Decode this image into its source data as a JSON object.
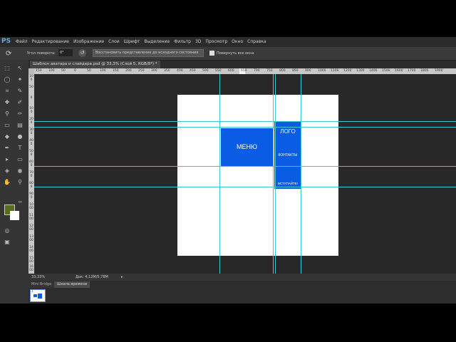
{
  "app": {
    "logo": "PS"
  },
  "menu": [
    "Файл",
    "Редактирование",
    "Изображение",
    "Слои",
    "Шрифт",
    "Выделение",
    "Фильтр",
    "3D",
    "Просмотр",
    "Окно",
    "Справка"
  ],
  "options": {
    "angle_label": "Угол поворота:",
    "angle_value": "0°",
    "reset_button": "Восстановить представление до исходного состояния",
    "rotate_all_label": "Повернуть все окна"
  },
  "document_tab": {
    "title": "Шаблон аватара и слайдера.psd @ 33,3% (Слой 5, RGB/8*) *"
  },
  "ruler": {
    "top": [
      "150",
      "100",
      "50",
      "0",
      "50",
      "100",
      "150",
      "200",
      "250",
      "300",
      "350",
      "400",
      "450",
      "500",
      "550",
      "600",
      "650",
      "700",
      "750",
      "800",
      "850",
      "900",
      "1000",
      "1100",
      "1200",
      "1300",
      "1400",
      "1500",
      "1600",
      "1700",
      "1800",
      "1900"
    ],
    "left": [
      "100",
      "50",
      "0",
      "100",
      "200",
      "300",
      "400",
      "500",
      "600",
      "700",
      "800",
      "900",
      "1000",
      "1100",
      "1200",
      "1300",
      "1400",
      "1500",
      "1600"
    ]
  },
  "canvas": {
    "menu_text": "МЕНЮ",
    "logo_text": "ЛОГО",
    "contacts_text": "КОНТАКТЫ",
    "join_text": "ВСТУПАЙТЕ!",
    "block_color": "#0a5ce4",
    "guide_color": "#3cc8d0"
  },
  "status": {
    "zoom": "33,33%",
    "doc_info": "Док: 4,12M/5,78M"
  },
  "bottom_tabs": [
    "Mini Bridge",
    "Шкала времени"
  ],
  "timeline": {
    "frame_number": "1"
  },
  "colors": {
    "foreground": "#566d1e",
    "background": "#ffffff"
  }
}
